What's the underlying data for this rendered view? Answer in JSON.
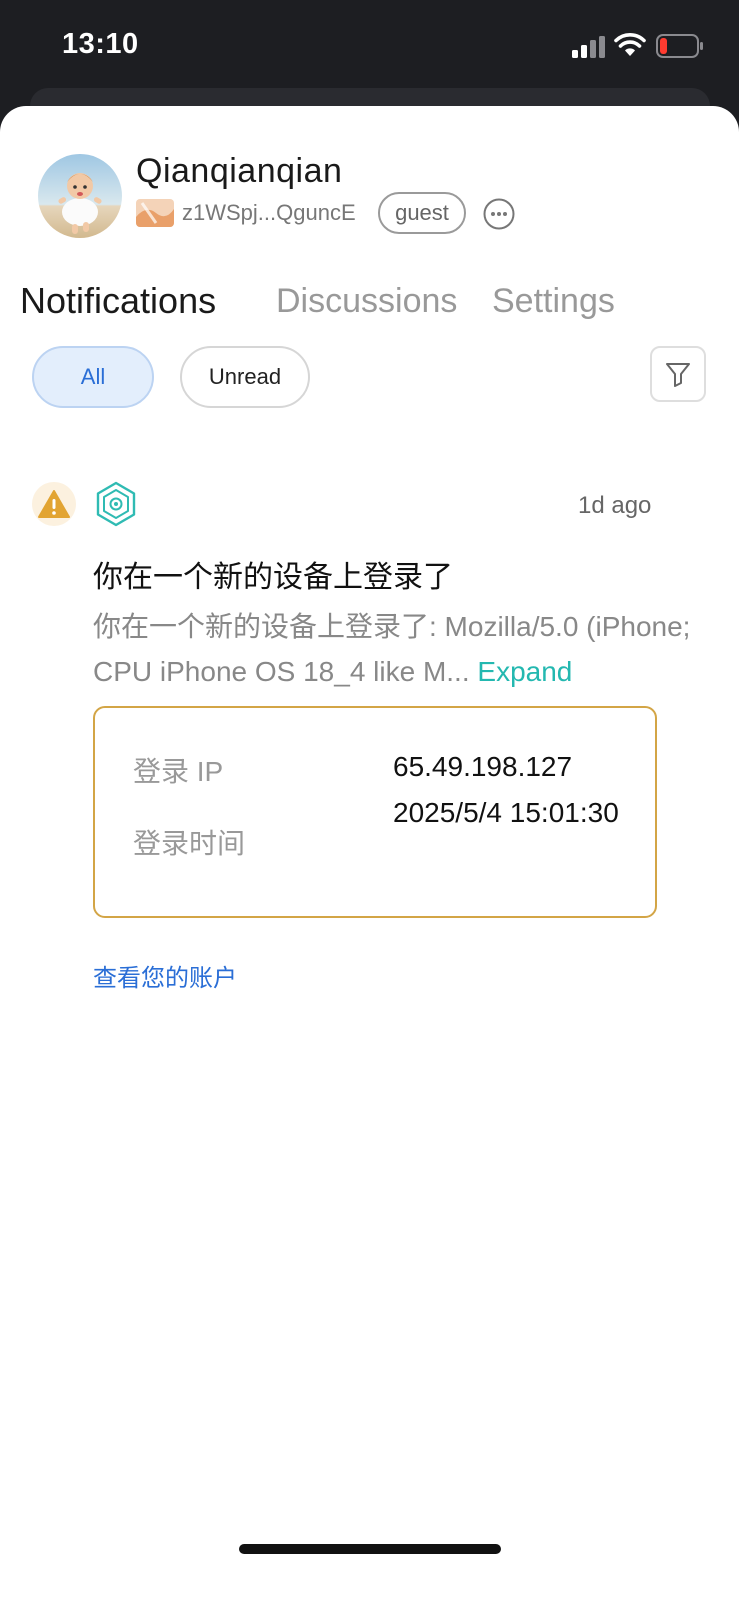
{
  "status_bar": {
    "time": "13:10",
    "signal_icon": "signal-icon",
    "wifi_icon": "wifi-icon",
    "battery_icon": "battery-low-icon",
    "battery_level": 0.1
  },
  "profile": {
    "name": "Qianqianqian",
    "address": "z1WSpj...QguncE",
    "role": "guest",
    "more_icon": "more-horizontal-icon"
  },
  "tabs": [
    {
      "label": "Notifications",
      "active": true
    },
    {
      "label": "Discussions",
      "active": false
    },
    {
      "label": "Settings",
      "active": false
    }
  ],
  "filters": {
    "all_label": "All",
    "unread_label": "Unread",
    "selected": "All",
    "filter_icon": "funnel-icon"
  },
  "notification": {
    "severity_icon": "warning-icon",
    "app_icon": "hex-gear-icon",
    "time_ago": "1d ago",
    "title": "你在一个新的设备上登录了",
    "body": "你在一个新的设备上登录了: Mozilla/5.0 (iPhone; CPU iPhone OS 18_4 like M...",
    "expand_label": "Expand",
    "details": {
      "ip_label": "登录 IP",
      "ip_value": "65.49.198.127",
      "time_label": "登录时间",
      "time_value": "2025/5/4 15:01:30"
    },
    "link_label": "查看您的账户"
  },
  "colors": {
    "accent_blue": "#2a6ed6",
    "accent_teal": "#23b8b0",
    "warning": "#e2a432",
    "box_border": "#d3a546"
  }
}
